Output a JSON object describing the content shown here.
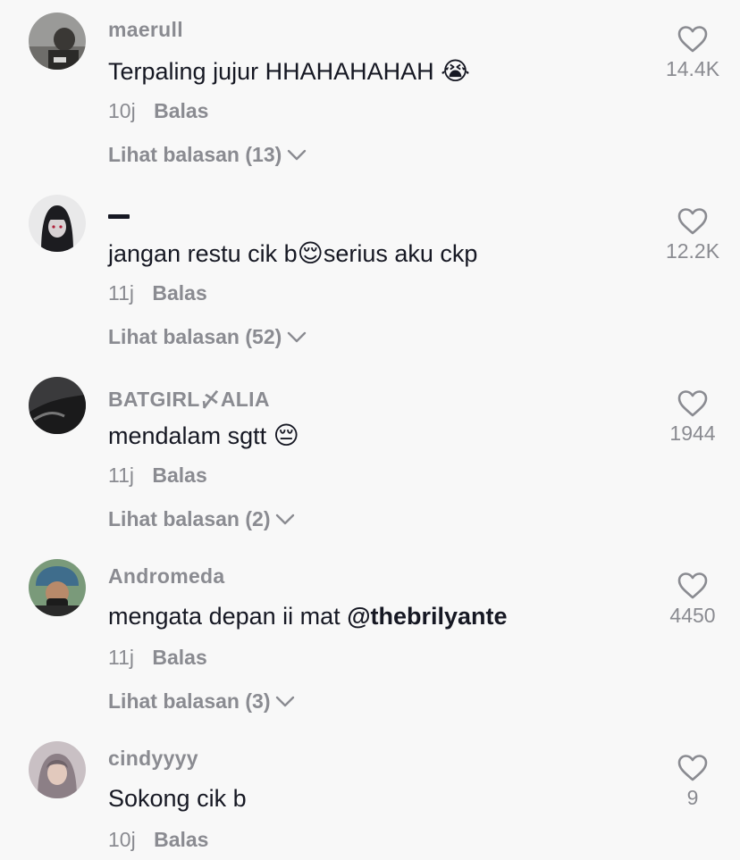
{
  "comments": [
    {
      "username": "maerull",
      "text": "Terpaling jujur HHAHAHAHAH",
      "emoji": "😭",
      "mention": "",
      "time": "10j",
      "reply_label": "Balas",
      "view_replies": "Lihat balasan (13)",
      "likes": "14.4K"
    },
    {
      "username": "",
      "text": "jangan restu cik b",
      "emoji": "😌",
      "text_after": "serius aku ckp",
      "mention": "",
      "time": "11j",
      "reply_label": "Balas",
      "view_replies": "Lihat balasan (52)",
      "likes": "12.2K"
    },
    {
      "username": "BATGIRL〆ALIA",
      "text": "mendalam sgtt",
      "emoji": "😔",
      "mention": "",
      "time": "11j",
      "reply_label": "Balas",
      "view_replies": "Lihat balasan (2)",
      "likes": "1944"
    },
    {
      "username": "Andromeda",
      "text": "mengata depan ii mat",
      "emoji": "",
      "mention": "@thebrilyante",
      "time": "11j",
      "reply_label": "Balas",
      "view_replies": "Lihat balasan (3)",
      "likes": "4450"
    },
    {
      "username": "cindyyyy",
      "text": "Sokong cik b",
      "emoji": "",
      "mention": "",
      "time": "10j",
      "reply_label": "Balas",
      "view_replies": "",
      "likes": "9"
    }
  ],
  "icons": {
    "like": "heart-outline-icon",
    "expand": "chevron-down-icon"
  },
  "colors": {
    "background": "#f8f8f8",
    "text_primary": "#161823",
    "text_secondary": "#8a8b91"
  }
}
